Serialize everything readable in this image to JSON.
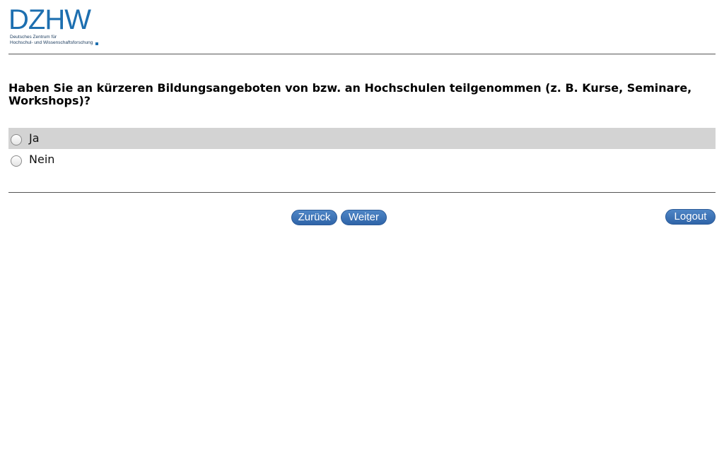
{
  "logo": {
    "mark": "DZHW",
    "subtitle_line1": "Deutsches Zentrum für",
    "subtitle_line2": "Hochschul- und Wissenschaftsforschung"
  },
  "question": {
    "text": "Haben Sie an kürzeren Bildungsangeboten von bzw. an Hochschulen teilgenommen (z. B. Kurse, Seminare, Workshops)?"
  },
  "options": [
    {
      "label": "Ja"
    },
    {
      "label": "Nein"
    }
  ],
  "buttons": {
    "back": "Zurück",
    "next": "Weiter",
    "logout": "Logout"
  },
  "colors": {
    "brand": "#1d6fb0",
    "button": "#3a70b5",
    "highlight_row": "#d3d3d3"
  }
}
